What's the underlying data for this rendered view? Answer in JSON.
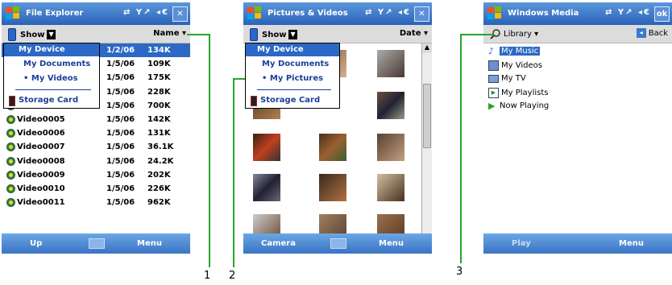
{
  "screen1": {
    "title": "File Explorer",
    "status_icons": "⇄ Y↗ ◂€",
    "close": "✕",
    "show_label": "Show",
    "sort_label": "Name ▾",
    "dropdown": [
      {
        "label": "My Device"
      },
      {
        "label": "My Documents"
      },
      {
        "label": "• My Videos"
      },
      {
        "label": "Storage Card"
      }
    ],
    "files": [
      {
        "name": "",
        "date": "1/2/06",
        "size": "134K"
      },
      {
        "name": "",
        "date": "1/5/06",
        "size": "109K"
      },
      {
        "name": "",
        "date": "1/5/06",
        "size": "175K"
      },
      {
        "name": "",
        "date": "1/5/06",
        "size": "228K"
      },
      {
        "name": "Video0004",
        "date": "1/5/06",
        "size": "700K"
      },
      {
        "name": "Video0005",
        "date": "1/5/06",
        "size": "142K"
      },
      {
        "name": "Video0006",
        "date": "1/5/06",
        "size": "131K"
      },
      {
        "name": "Video0007",
        "date": "1/5/06",
        "size": "36.1K"
      },
      {
        "name": "Video0008",
        "date": "1/5/06",
        "size": "24.2K"
      },
      {
        "name": "Video0009",
        "date": "1/5/06",
        "size": "202K"
      },
      {
        "name": "Video0010",
        "date": "1/5/06",
        "size": "226K"
      },
      {
        "name": "Video0011",
        "date": "1/5/06",
        "size": "962K"
      }
    ],
    "bottom_left": "Up",
    "bottom_right": "Menu"
  },
  "screen2": {
    "title": "Pictures & Videos",
    "status_icons": "⇄ Y↗ ◂€",
    "close": "✕",
    "show_label": "Show",
    "sort_label": "Date ▾",
    "dropdown": [
      {
        "label": "My Device"
      },
      {
        "label": "My Documents"
      },
      {
        "label": "• My Pictures"
      },
      {
        "label": "Storage Card"
      }
    ],
    "bottom_left": "Camera",
    "bottom_right": "Menu"
  },
  "screen3": {
    "title": "Windows Media",
    "status_icons": "⇄ Y↗ ◂€",
    "ok": "ok",
    "library_label": "Library ▾",
    "back_label": "Back",
    "items": [
      {
        "label": "My Music"
      },
      {
        "label": "My Videos"
      },
      {
        "label": "My TV"
      },
      {
        "label": "My Playlists"
      },
      {
        "label": "Now Playing"
      }
    ],
    "bottom_left": "Play",
    "bottom_right": "Menu"
  },
  "callouts": {
    "one": "1",
    "two": "2",
    "three": "3"
  },
  "colors": {
    "titlebar": "#2a62b8",
    "selection": "#2c68c5",
    "callout": "#25a52b"
  }
}
